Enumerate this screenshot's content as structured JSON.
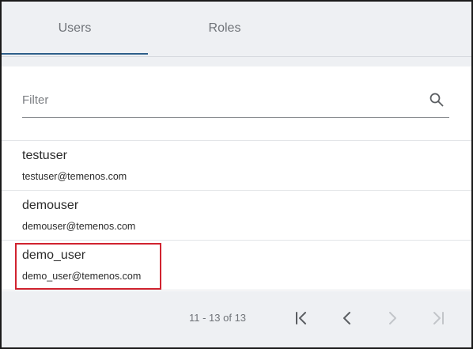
{
  "tabs": [
    {
      "label": "Users",
      "active": true
    },
    {
      "label": "Roles",
      "active": false
    }
  ],
  "filter": {
    "placeholder": "Filter",
    "value": ""
  },
  "users": [
    {
      "name": "testuser",
      "email": "testuser@temenos.com"
    },
    {
      "name": "demouser",
      "email": "demouser@temenos.com"
    },
    {
      "name": "demo_user",
      "email": "demo_user@temenos.com",
      "highlighted": true
    }
  ],
  "pagination": {
    "range_text": "11 - 13 of 13",
    "first_enabled": true,
    "prev_enabled": true,
    "next_enabled": false,
    "last_enabled": false
  },
  "colors": {
    "accent": "#2e5f8a",
    "highlight_border": "#d1232f",
    "enabled_icon": "#5a5d61",
    "disabled_icon": "#c2c5c9",
    "background": "#eef0f3"
  }
}
